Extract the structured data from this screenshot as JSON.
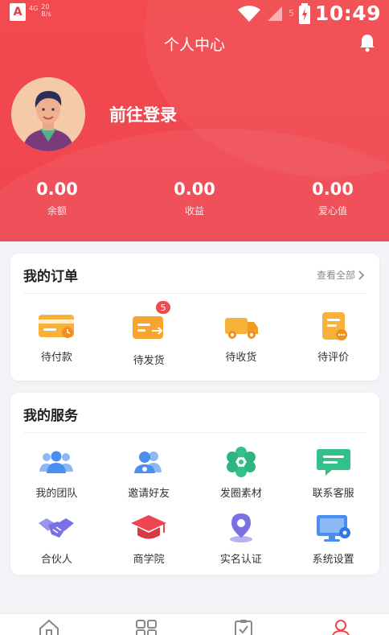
{
  "status_bar": {
    "app_letter": "A",
    "signal_text": "4G",
    "net_speed": "20",
    "net_unit": "B/s",
    "time": "10:49",
    "faint_text": "5"
  },
  "header": {
    "title": "个人中心",
    "login_text": "前往登录",
    "stats": [
      {
        "value": "0.00",
        "label": "余额"
      },
      {
        "value": "0.00",
        "label": "收益"
      },
      {
        "value": "0.00",
        "label": "爱心值"
      }
    ]
  },
  "orders": {
    "title": "我的订单",
    "view_all": "查看全部",
    "items": [
      {
        "label": "待付款",
        "icon": "wallet-card-icon"
      },
      {
        "label": "待发货",
        "icon": "shipment-icon",
        "badge": "5"
      },
      {
        "label": "待收货",
        "icon": "delivery-truck-icon"
      },
      {
        "label": "待评价",
        "icon": "review-document-icon"
      }
    ]
  },
  "services": {
    "title": "我的服务",
    "items": [
      {
        "label": "我的团队",
        "icon": "team-icon"
      },
      {
        "label": "邀请好友",
        "icon": "invite-friend-icon"
      },
      {
        "label": "发圈素材",
        "icon": "material-flower-icon"
      },
      {
        "label": "联系客服",
        "icon": "customer-service-chat-icon"
      },
      {
        "label": "合伙人",
        "icon": "handshake-icon"
      },
      {
        "label": "商学院",
        "icon": "graduation-cap-icon"
      },
      {
        "label": "实名认证",
        "icon": "location-verify-icon"
      },
      {
        "label": "系统设置",
        "icon": "monitor-settings-icon"
      }
    ]
  },
  "tabbar": {
    "tabs": [
      {
        "icon": "home-icon"
      },
      {
        "icon": "category-grid-icon"
      },
      {
        "icon": "clipboard-check-icon"
      },
      {
        "icon": "user-profile-icon",
        "active": true
      }
    ]
  },
  "colors": {
    "brand_red": "#ef4550",
    "order_orange": "#f5a52b",
    "service_blue": "#4a8ff0",
    "service_green": "#33c08a",
    "service_purple": "#7b6fe6"
  }
}
